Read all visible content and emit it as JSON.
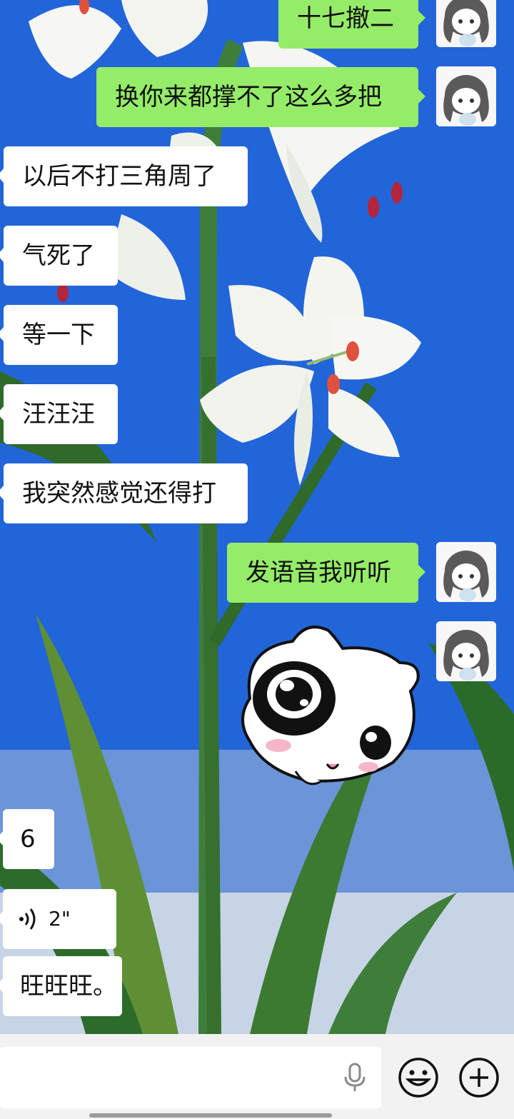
{
  "colors": {
    "sent_bubble": "#95ec69",
    "received_bubble": "#ffffff",
    "input_bar": "#f2f2f2",
    "wallpaper_sky": "#1f63d6"
  },
  "messages": [
    {
      "side": "out",
      "text": "十七撤二"
    },
    {
      "side": "out",
      "text": "换你来都撑不了这么多把"
    },
    {
      "side": "in",
      "text": "以后不打三角周了"
    },
    {
      "side": "in",
      "text": "气死了"
    },
    {
      "side": "in",
      "text": "等一下"
    },
    {
      "side": "in",
      "text": "汪汪汪"
    },
    {
      "side": "in",
      "text": "我突然感觉还得打"
    },
    {
      "side": "out",
      "text": "发语音我听听"
    },
    {
      "side": "out",
      "sticker": "crying-white-cat-sticker"
    },
    {
      "side": "in",
      "text": "6"
    },
    {
      "side": "in",
      "voice_duration": "2\""
    },
    {
      "side": "in",
      "text": "旺旺旺。"
    }
  ],
  "input_bar": {
    "voice_icon": "microphone-icon",
    "emoji_icon": "smiley-face-icon",
    "more_icon": "plus-circle-icon"
  }
}
